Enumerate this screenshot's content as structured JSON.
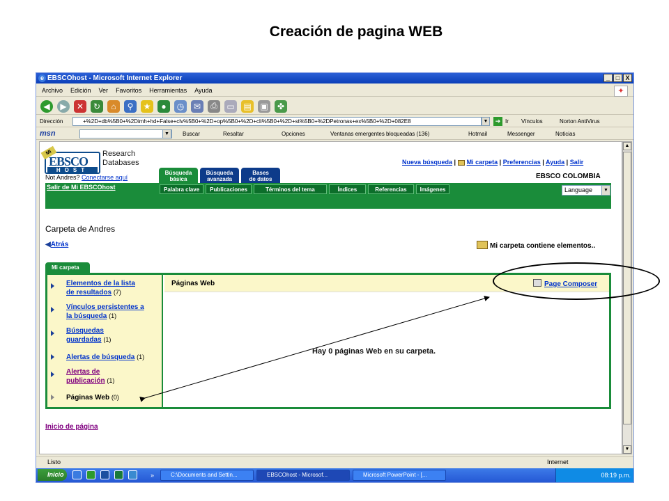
{
  "slide": {
    "title": "Creación de pagina WEB"
  },
  "window": {
    "title": "EBSCOhost - Microsoft Internet Explorer",
    "min": "_",
    "max": "□",
    "close": "X"
  },
  "menu": [
    "Archivo",
    "Edición",
    "Ver",
    "Favoritos",
    "Herramientas",
    "Ayuda"
  ],
  "address": {
    "label": "Dirección",
    "url": "+%2D+db%5B0+%2Dimh+hd+False+clv%5B0+%2D+op%5B0+%2D+cli%5B0+%2D+st%5B0+%2DPetronas+ex%5B0+%2D+082E8",
    "go": "Ir",
    "vinculos": "Vínculos",
    "norton": "Norton AntiVirus"
  },
  "msn": {
    "logo": "msn",
    "buscar": "Buscar",
    "resaltar": "Resaltar",
    "opciones": "Opciones",
    "ventanas": "Ventanas emergentes bloqueadas (136)",
    "hotmail": "Hotmail",
    "messenger": "Messenger",
    "noticias": "Noticias"
  },
  "ebsco": {
    "logo_mi": "MI",
    "logo_top": "EBSCO",
    "logo_host": "HOST",
    "rdb1": "Research",
    "rdb2": "Databases",
    "not_user": "Not Andres?",
    "connect": "Conectarse aquí",
    "tabs": [
      {
        "l1": "Búsqueda",
        "l2": "básica"
      },
      {
        "l1": "Búsqueda",
        "l2": "avanzada"
      },
      {
        "l1": "Bases",
        "l2": "de datos"
      }
    ],
    "toplinks": {
      "nueva": "Nueva búsqueda",
      "sep": "|",
      "carpeta": "Mi carpeta",
      "pref": "Preferencias",
      "ayuda": "Ayuda",
      "salir": "Salir"
    },
    "colombia": "EBSCO COLOMBIA",
    "salir_mi": "Salir de Mi EBSCOhost",
    "subtabs": [
      "Palabra clave",
      "Publicaciones",
      "Términos del tema",
      "Índices",
      "Referencias",
      "Imágenes"
    ],
    "language": "Language",
    "carpeta_title": "Carpeta de Andres",
    "atras": "Atrás",
    "contiene": "Mi carpeta contiene elementos..",
    "mi_tab": "Mi carpeta",
    "side": [
      {
        "l1": "Elementos de la lista",
        "l2": "de resultados",
        "count": "(7)"
      },
      {
        "l1": "Vínculos persistentes a",
        "l2": "la búsqueda",
        "count": "(1)"
      },
      {
        "l1": "Búsquedas",
        "l2": "guardadas",
        "count": "(1)"
      },
      {
        "l1": "Alertas de búsqueda",
        "count": "(1)"
      },
      {
        "l1": "Alertas de",
        "l2": "publicación",
        "count": "(1)"
      },
      {
        "l1": "Páginas Web",
        "count": "(0)"
      }
    ],
    "main_label": "Páginas Web",
    "composer": "Page Composer",
    "hay": "Hay 0 páginas Web en su carpeta.",
    "inicio": "Inicio de página"
  },
  "status": {
    "left": "Listo",
    "right": "Internet"
  },
  "taskbar": {
    "start": "Inicio",
    "tasks": [
      "C:\\Documents and Settin...",
      "EBSCOhost - Microsof...",
      "Microsoft PowerPoint - [..."
    ],
    "clock": "08:19 p.m."
  }
}
